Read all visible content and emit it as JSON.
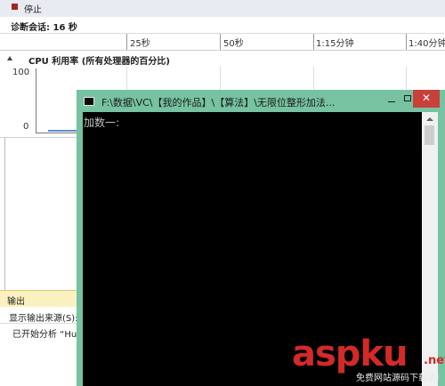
{
  "toolbar": {
    "stop_label": "停止"
  },
  "session": {
    "label": "诊断会话: 16 秒"
  },
  "timeline": {
    "ticks": [
      "25秒",
      "50秒",
      "1:15分钟",
      "1:40分钟"
    ]
  },
  "cpu": {
    "title": "CPU 利用率 (所有处理器的百分比)",
    "y_max_label": "100",
    "y_min_label": "0"
  },
  "output": {
    "title": "输出",
    "source_label": "显示输出来源(S):",
    "line": "已开始分析 “Hu"
  },
  "console": {
    "title": "F:\\数据\\VC\\【我的作品】\\【算法】\\无限位整形加法...",
    "prompt": "加数一:",
    "close_label": "✕"
  },
  "watermark": {
    "brand": "aspku",
    "suffix": ".net",
    "subtitle": "免费网站源码下载站!"
  },
  "colors": {
    "console_border": "#76c2a1",
    "close_button": "#c7403a",
    "output_header": "#fbf1c0",
    "watermark": "#d22a2a"
  }
}
